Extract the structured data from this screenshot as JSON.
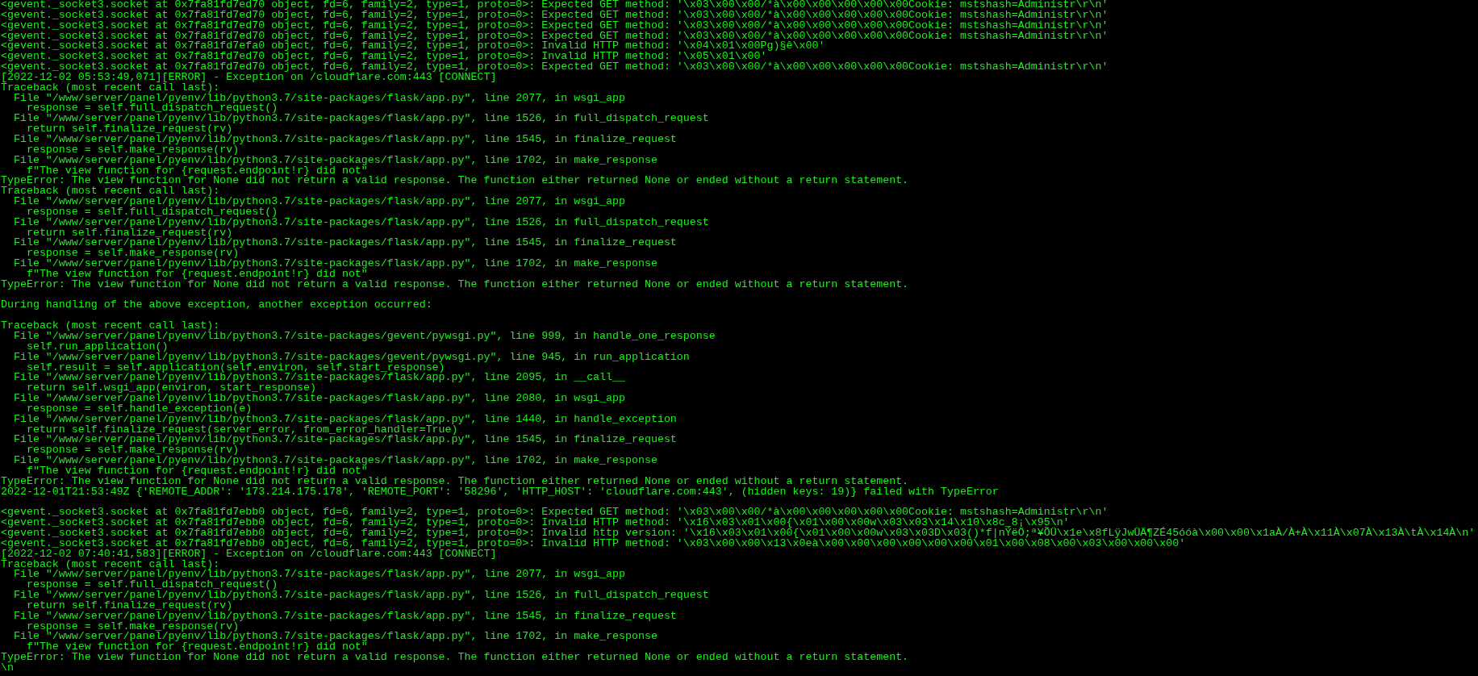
{
  "terminal": {
    "lines": [
      {
        "kind": "text",
        "text": "<gevent._socket3.socket at 0x7fa81fd7ed70 object, fd=6, family=2, type=1, proto=0>: Expected GET method: '\\x03\\x00\\x00/*à\\x00\\x00\\x00\\x00\\x00Cookie: mstshash=Administr\\r\\n'"
      },
      {
        "kind": "text",
        "text": "<gevent._socket3.socket at 0x7fa81fd7ed70 object, fd=6, family=2, type=1, proto=0>: Expected GET method: '\\x03\\x00\\x00/*à\\x00\\x00\\x00\\x00\\x00Cookie: mstshash=Administr\\r\\n'"
      },
      {
        "kind": "text",
        "text": "<gevent._socket3.socket at 0x7fa81fd7ed70 object, fd=6, family=2, type=1, proto=0>: Expected GET method: '\\x03\\x00\\x00/*à\\x00\\x00\\x00\\x00\\x00Cookie: mstshash=Administr\\r\\n'"
      },
      {
        "kind": "text",
        "text": "<gevent._socket3.socket at 0x7fa81fd7ed70 object, fd=6, family=2, type=1, proto=0>: Expected GET method: '\\x03\\x00\\x00/*à\\x00\\x00\\x00\\x00\\x00Cookie: mstshash=Administr\\r\\n'"
      },
      {
        "kind": "text",
        "text": "<gevent._socket3.socket at 0x7fa81fd7efa0 object, fd=6, family=2, type=1, proto=0>: Invalid HTTP method: '\\x04\\x01\\x00Pg)§ê\\x00'"
      },
      {
        "kind": "text",
        "text": "<gevent._socket3.socket at 0x7fa81fd7ed70 object, fd=6, family=2, type=1, proto=0>: Invalid HTTP method: '\\x05\\x01\\x00'"
      },
      {
        "kind": "text",
        "text": "<gevent._socket3.socket at 0x7fa81fd7ed70 object, fd=6, family=2, type=1, proto=0>: Expected GET method: '\\x03\\x00\\x00/*à\\x00\\x00\\x00\\x00\\x00Cookie: mstshash=Administr\\r\\n'"
      },
      {
        "kind": "text",
        "text": "[2022-12-02 05:53:49,071][ERROR] - Exception on /cloudflare.com:443 [CONNECT]"
      },
      {
        "kind": "text",
        "text": "Traceback (most recent call last):"
      },
      {
        "kind": "text",
        "text": "  File \"/www/server/panel/pyenv/lib/python3.7/site-packages/flask/app.py\", line 2077, in wsgi_app"
      },
      {
        "kind": "text",
        "text": "    response = self.full_dispatch_request()"
      },
      {
        "kind": "text",
        "text": "  File \"/www/server/panel/pyenv/lib/python3.7/site-packages/flask/app.py\", line 1526, in full_dispatch_request"
      },
      {
        "kind": "text",
        "text": "    return self.finalize_request(rv)"
      },
      {
        "kind": "text",
        "text": "  File \"/www/server/panel/pyenv/lib/python3.7/site-packages/flask/app.py\", line 1545, in finalize_request"
      },
      {
        "kind": "text",
        "text": "    response = self.make_response(rv)"
      },
      {
        "kind": "text",
        "text": "  File \"/www/server/panel/pyenv/lib/python3.7/site-packages/flask/app.py\", line 1702, in make_response"
      },
      {
        "kind": "text",
        "text": "    f\"The view function for {request.endpoint!r} did not\""
      },
      {
        "kind": "text",
        "text": "TypeError: The view function for None did not return a valid response. The function either returned None or ended without a return statement."
      },
      {
        "kind": "text",
        "text": "Traceback (most recent call last):"
      },
      {
        "kind": "text",
        "text": "  File \"/www/server/panel/pyenv/lib/python3.7/site-packages/flask/app.py\", line 2077, in wsgi_app"
      },
      {
        "kind": "text",
        "text": "    response = self.full_dispatch_request()"
      },
      {
        "kind": "text",
        "text": "  File \"/www/server/panel/pyenv/lib/python3.7/site-packages/flask/app.py\", line 1526, in full_dispatch_request"
      },
      {
        "kind": "text",
        "text": "    return self.finalize_request(rv)"
      },
      {
        "kind": "text",
        "text": "  File \"/www/server/panel/pyenv/lib/python3.7/site-packages/flask/app.py\", line 1545, in finalize_request"
      },
      {
        "kind": "text",
        "text": "    response = self.make_response(rv)"
      },
      {
        "kind": "text",
        "text": "  File \"/www/server/panel/pyenv/lib/python3.7/site-packages/flask/app.py\", line 1702, in make_response"
      },
      {
        "kind": "text",
        "text": "    f\"The view function for {request.endpoint!r} did not\""
      },
      {
        "kind": "text",
        "text": "TypeError: The view function for None did not return a valid response. The function either returned None or ended without a return statement."
      },
      {
        "kind": "blank"
      },
      {
        "kind": "text",
        "text": "During handling of the above exception, another exception occurred:"
      },
      {
        "kind": "blank"
      },
      {
        "kind": "text",
        "text": "Traceback (most recent call last):"
      },
      {
        "kind": "text",
        "text": "  File \"/www/server/panel/pyenv/lib/python3.7/site-packages/gevent/pywsgi.py\", line 999, in handle_one_response"
      },
      {
        "kind": "text",
        "text": "    self.run_application()"
      },
      {
        "kind": "text",
        "text": "  File \"/www/server/panel/pyenv/lib/python3.7/site-packages/gevent/pywsgi.py\", line 945, in run_application"
      },
      {
        "kind": "text",
        "text": "    self.result = self.application(self.environ, self.start_response)"
      },
      {
        "kind": "text",
        "text": "  File \"/www/server/panel/pyenv/lib/python3.7/site-packages/flask/app.py\", line 2095, in __call__"
      },
      {
        "kind": "text",
        "text": "    return self.wsgi_app(environ, start_response)"
      },
      {
        "kind": "text",
        "text": "  File \"/www/server/panel/pyenv/lib/python3.7/site-packages/flask/app.py\", line 2080, in wsgi_app"
      },
      {
        "kind": "text",
        "text": "    response = self.handle_exception(e)"
      },
      {
        "kind": "text",
        "text": "  File \"/www/server/panel/pyenv/lib/python3.7/site-packages/flask/app.py\", line 1440, in handle_exception"
      },
      {
        "kind": "text",
        "text": "    return self.finalize_request(server_error, from_error_handler=True)"
      },
      {
        "kind": "text",
        "text": "  File \"/www/server/panel/pyenv/lib/python3.7/site-packages/flask/app.py\", line 1545, in finalize_request"
      },
      {
        "kind": "text",
        "text": "    response = self.make_response(rv)"
      },
      {
        "kind": "text",
        "text": "  File \"/www/server/panel/pyenv/lib/python3.7/site-packages/flask/app.py\", line 1702, in make_response"
      },
      {
        "kind": "text",
        "text": "    f\"The view function for {request.endpoint!r} did not\""
      },
      {
        "kind": "text",
        "text": "TypeError: The view function for None did not return a valid response. The function either returned None or ended without a return statement."
      },
      {
        "kind": "text",
        "text": "2022-12-01T21:53:49Z {'REMOTE_ADDR': '173.214.175.178', 'REMOTE_PORT': '58296', 'HTTP_HOST': 'cloudflare.com:443', (hidden keys: 19)} failed with TypeError"
      },
      {
        "kind": "blank"
      },
      {
        "kind": "text",
        "text": "<gevent._socket3.socket at 0x7fa81fd7ebb0 object, fd=6, family=2, type=1, proto=0>: Expected GET method: '\\x03\\x00\\x00/*à\\x00\\x00\\x00\\x00\\x00Cookie: mstshash=Administr\\r\\n'"
      },
      {
        "kind": "text",
        "text": "<gevent._socket3.socket at 0x7fa81fd7ebb0 object, fd=6, family=2, type=1, proto=0>: Invalid HTTP method: '\\x16\\x03\\x01\\x00{\\x01\\x00\\x00w\\x03\\x03\\x14\\x10\\x8c_8¡\\x95\\n'"
      },
      {
        "kind": "text",
        "text": "<gevent._socket3.socket at 0x7fa81fd7ebb0 object, fd=6, family=2, type=1, proto=0>: Invalid http version: '\\x16\\x03\\x01\\x00{\\x01\\x00\\x00w\\x03\\x03D\\x03()*f|nÝëÖ;ª¥ÕÜ\\x1e\\x8fLÿJwÜÄ¶ZÉ45óóà\\x00\\x00\\x1aÀ/À+À\\x11À\\x07À\\x13À\\tÀ\\x14À\\n'"
      },
      {
        "kind": "text",
        "text": "<gevent._socket3.socket at 0x7fa81fd7ebb0 object, fd=6, family=2, type=1, proto=0>: Invalid HTTP method: '\\x03\\x00\\x00\\x13\\x0eà\\x00\\x00\\x00\\x00\\x00\\x00\\x01\\x00\\x08\\x00\\x03\\x00\\x00\\x00'"
      },
      {
        "kind": "text",
        "text": "[2022-12-02 07:40:41,583][ERROR] - Exception on /cloudflare.com:443 [CONNECT]"
      },
      {
        "kind": "text",
        "text": "Traceback (most recent call last):"
      },
      {
        "kind": "text",
        "text": "  File \"/www/server/panel/pyenv/lib/python3.7/site-packages/flask/app.py\", line 2077, in wsgi_app"
      },
      {
        "kind": "text",
        "text": "    response = self.full_dispatch_request()"
      },
      {
        "kind": "text",
        "text": "  File \"/www/server/panel/pyenv/lib/python3.7/site-packages/flask/app.py\", line 1526, in full_dispatch_request"
      },
      {
        "kind": "text",
        "text": "    return self.finalize_request(rv)"
      },
      {
        "kind": "text",
        "text": "  File \"/www/server/panel/pyenv/lib/python3.7/site-packages/flask/app.py\", line 1545, in finalize_request"
      },
      {
        "kind": "text",
        "text": "    response = self.make_response(rv)"
      },
      {
        "kind": "text",
        "text": "  File \"/www/server/panel/pyenv/lib/python3.7/site-packages/flask/app.py\", line 1702, in make_response"
      },
      {
        "kind": "text",
        "text": "    f\"The view function for {request.endpoint!r} did not\""
      },
      {
        "kind": "text",
        "text": "TypeError: The view function for None did not return a valid response. The function either returned None or ended without a return statement."
      },
      {
        "kind": "text",
        "text": "\\n"
      }
    ]
  }
}
